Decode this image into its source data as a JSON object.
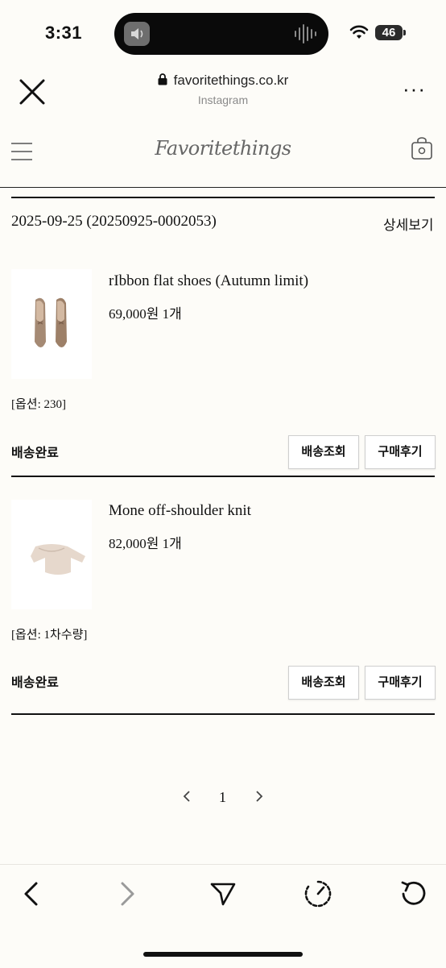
{
  "status_bar": {
    "time": "3:31",
    "battery": "46"
  },
  "browser": {
    "url": "favoritethings.co.kr",
    "subtitle": "Instagram",
    "more": "···"
  },
  "site": {
    "logo": "Favoritethings"
  },
  "order": {
    "date": "2025-09-25",
    "order_no": "(20250925-0002053)",
    "detail_label": "상세보기"
  },
  "items": [
    {
      "name": "rIbbon flat shoes (Autumn limit)",
      "price": "69,000원 1개",
      "option": "[옵션: 230]",
      "status": "배송완료",
      "track_label": "배송조회",
      "review_label": "구매후기"
    },
    {
      "name": "Mone off-shoulder knit",
      "price": "82,000원 1개",
      "option": "[옵션: 1차수량]",
      "status": "배송완료",
      "track_label": "배송조회",
      "review_label": "구매후기"
    }
  ],
  "pagination": {
    "prev": "‹",
    "current": "1",
    "next": "›"
  },
  "colors": {
    "background": "#fdfcf8",
    "text": "#111111",
    "disabled": "#9a9a9a"
  }
}
